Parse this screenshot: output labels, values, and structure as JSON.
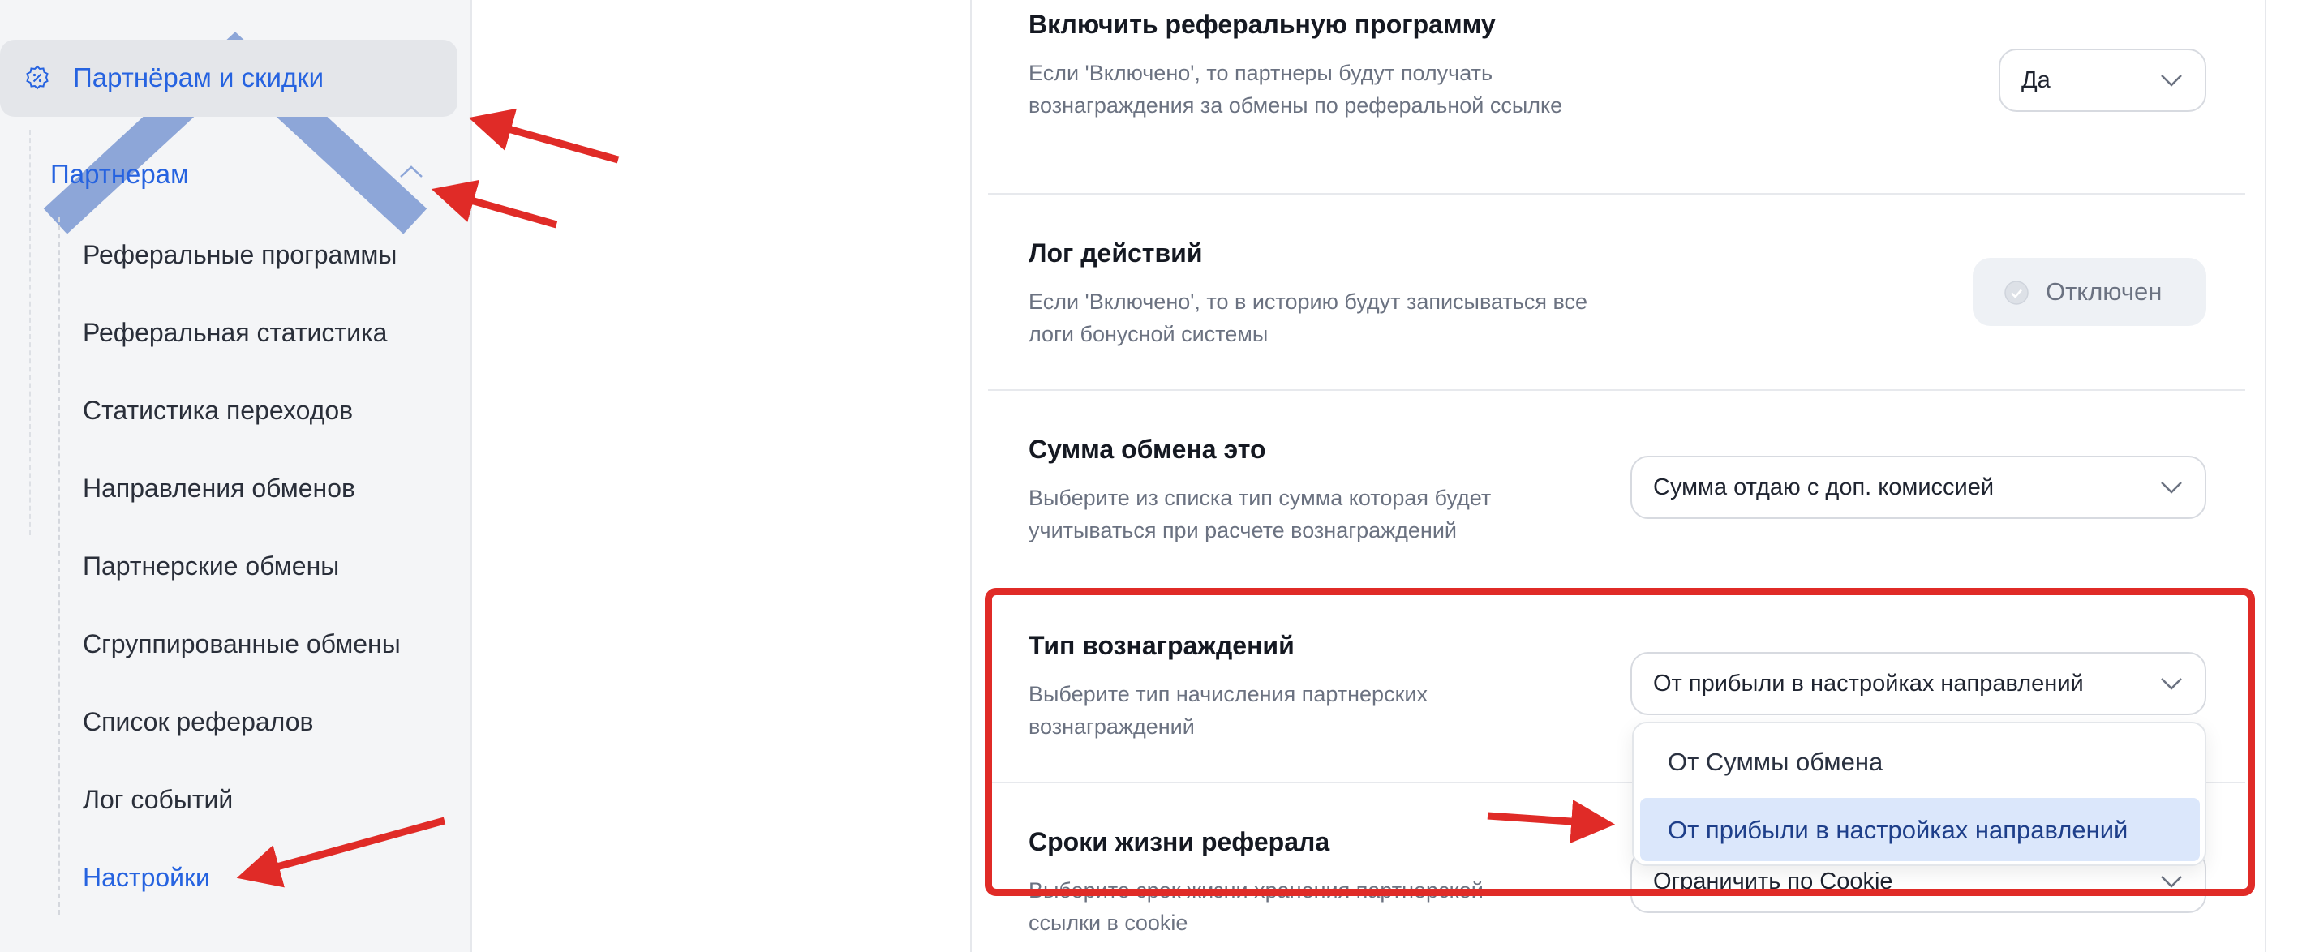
{
  "sidebar": {
    "group_label": "Партнёрам и скидки",
    "sub_label": "Партнерам",
    "items": [
      {
        "label": "Реферальные программы"
      },
      {
        "label": "Реферальная статистика"
      },
      {
        "label": "Статистика переходов"
      },
      {
        "label": "Направления обменов"
      },
      {
        "label": "Партнерские обмены"
      },
      {
        "label": "Сгруппированные обмены"
      },
      {
        "label": "Список рефералов"
      },
      {
        "label": "Лог событий"
      },
      {
        "label": "Настройки"
      }
    ],
    "active_item": "Настройки"
  },
  "settings": [
    {
      "title": "Включить реферальную программу",
      "description": "Если 'Включено', то партнеры будут получать вознаграждения за обмены по реферальной ссылке",
      "control": "select",
      "value": "Да"
    },
    {
      "title": "Лог действий",
      "description": "Если 'Включено', то в историю будут записываться все логи бонусной системы",
      "control": "toggle",
      "value": "Отключен"
    },
    {
      "title": "Сумма обмена это",
      "description": "Выберите из списка тип сумма которая будет учитываться при расчете вознаграждений",
      "control": "select",
      "value": "Сумма отдаю с доп. комиссией"
    },
    {
      "title": "Тип вознаграждений",
      "description": "Выберите тип начисления партнерских вознаграждений",
      "control": "select",
      "value": "От прибыли в настройках направлений",
      "dropdown_open": true,
      "options": [
        "От Суммы обмена",
        "От прибыли в настройках направлений"
      ]
    },
    {
      "title": "Сроки жизни реферала",
      "description": "Выберите срок жизни хранения партнерской ссылки в cookie",
      "control": "select",
      "value": "Ограничить по Cookie"
    }
  ],
  "icons": {
    "group": "badge-percent-icon",
    "chevron_up": "chevron-up-icon",
    "chevron_down": "chevron-down-icon",
    "toggle_off": "check-circle-icon"
  },
  "colors": {
    "accent": "#2663e0",
    "annotation": "#e02b27",
    "selected_option_bg": "#dbe7fb"
  }
}
